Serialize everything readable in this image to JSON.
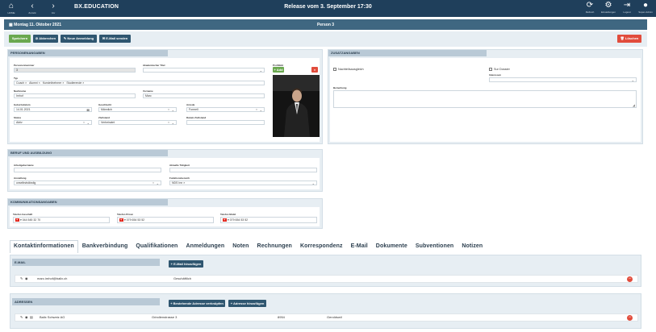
{
  "topbar": {
    "left_buttons": [
      {
        "icon": "home-icon",
        "glyph": "⌂",
        "label": "HOME"
      },
      {
        "icon": "back-icon",
        "glyph": "‹",
        "label": "Zurück"
      },
      {
        "icon": "forward-icon",
        "glyph": "›",
        "label": "Vor"
      }
    ],
    "brand": "BX.EDUCATION",
    "release": "Release vom 3. September 17:30",
    "right_buttons": [
      {
        "icon": "refresh-icon",
        "glyph": "⟳",
        "label": "Refresh"
      },
      {
        "icon": "settings-icon",
        "glyph": "⚙",
        "label": "Einstellungen"
      },
      {
        "icon": "logout-icon",
        "glyph": "⇥",
        "label": "Logout"
      },
      {
        "icon": "user-icon",
        "glyph": "●",
        "label": "Super-Admin"
      }
    ]
  },
  "datebar": {
    "date": "Montag 11. Oktober 2021",
    "title": "Person 3"
  },
  "actions": {
    "save": "Speichern",
    "cancel": "Abbrechen",
    "new_registration": "Neue Anmeldung",
    "send_email": "E-Mail senden",
    "delete": "Löschen"
  },
  "personal": {
    "header": "PERSONENANGABEN",
    "personnummer_label": "Personennummer",
    "personnummer_value": "3",
    "akad_titel_label": "Akademischer Titel",
    "akad_titel_value": "",
    "profilbild_label": "Profilbild",
    "add_label": "Add",
    "typ_label": "Typ",
    "typ_tags": [
      "Coach ×",
      "Alumni ×",
      "Kursteilnehmer ×",
      "Studierende ×"
    ],
    "nachname_label": "Nachname",
    "nachname_value": "Imhof",
    "vorname_label": "Vorname",
    "vorname_value": "Marc",
    "geburtsdatum_label": "Geburtsdatum",
    "geburtsdatum_value": "14.01.2021",
    "geschlecht_label": "Geschlecht",
    "geschlecht_value": "Männlich",
    "anrede_label": "Anrede",
    "anrede_value": "Formell",
    "status_label": "Status",
    "status_value": "Aktiv",
    "zivilstand_label": "Zivilstand",
    "zivilstand_value": "Verheiratet",
    "datum_zivilstand_label": "Datum Zivilstand",
    "datum_zivilstand_value": ""
  },
  "additional": {
    "header": "ZUSATZANGABEN",
    "nachteilsausgleich_label": "Nachteilsausgleich",
    "sur_dossier_label": "Sur Dossier",
    "interessen_label": "Interessen",
    "interessen_value": "",
    "bemerkung_label": "Bemerkung",
    "bemerkung_value": ""
  },
  "career": {
    "header": "BERUF UND AUSBILDUNG",
    "arbeitgeber_label": "Arbeitgebername",
    "arbeitgeber_value": "",
    "taetigkeit_label": "Aktuelle Tätigkeit",
    "taetigkeit_value": "",
    "anstellung_label": "Anstellung",
    "anstellung_value": "unselbstständig",
    "funktionsbereich_label": "Funktionsbereich",
    "funktionsbereich_value": "NDS Inn ×"
  },
  "communication": {
    "header": "KOMMUNIKATIONSANGABEN",
    "tel_geschaeft_label": "Telefon Geschäft",
    "tel_geschaeft_value": "044 545 32 70",
    "tel_privat_label": "Telefon Privat",
    "tel_privat_value": "079 654 53 52",
    "tel_mobil_label": "Telefon Mobil",
    "tel_mobil_value": "079 654 53 52"
  },
  "tabs": [
    "Kontaktinformationen",
    "Bankverbindung",
    "Qualifikationen",
    "Anmeldungen",
    "Noten",
    "Rechnungen",
    "Korrespondenz",
    "E-Mail",
    "Dokumente",
    "Subventionen",
    "Notizen"
  ],
  "email_section": {
    "header": "E-MAIL",
    "add_button": "E-Mail hinzufügen",
    "rows": [
      {
        "address": "marc.imhof@balix.ch",
        "type": "Geschäftlich"
      }
    ]
  },
  "address_section": {
    "header": "ADRESSEN",
    "link_button": "Bestehende Adresse verknüpfen",
    "add_button": "Adresse hinzufügen",
    "rows": [
      {
        "company": "Balix Schweiz AG",
        "street": "Grindlenstrasse 3",
        "zip": "8954",
        "city": "Geroldswil"
      }
    ]
  },
  "colors": {
    "topbar": "#1f3f5b",
    "datebar": "#3f6781",
    "panel": "#e7eef3",
    "panel_header": "#b9c9d6",
    "save": "#6aa84f",
    "delete": "#e14c3c",
    "button_dark": "#2f5670"
  }
}
